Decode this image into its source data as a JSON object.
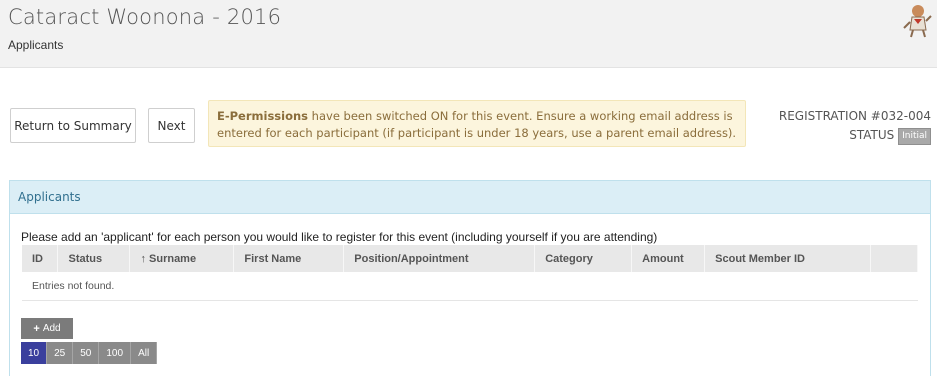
{
  "header": {
    "title": "Cataract Woonona - 2016",
    "subtitle": "Applicants"
  },
  "actions": {
    "return_label": "Return to Summary",
    "next_label": "Next"
  },
  "notice": {
    "bold": "E-Permissions",
    "text": " have been switched ON for this event. Ensure a working email address is entered for each participant (if participant is under 18 years, use a parent email address)."
  },
  "registration": {
    "number": "REGISTRATION #032-004",
    "status_label": "STATUS",
    "status_value": "Initial"
  },
  "panel": {
    "heading": "Applicants",
    "intro": "Please add an 'applicant' for each person you would like to register for this event (including yourself if you are attending)",
    "columns": [
      "ID",
      "Status",
      "↑ Surname",
      "First Name",
      "Position/Appointment",
      "Category",
      "Amount",
      "Scout Member ID",
      ""
    ],
    "empty_text": "Entries not found.",
    "add_label": "Add",
    "page_sizes": [
      "10",
      "25",
      "50",
      "100",
      "All"
    ],
    "page_size_selected": "10"
  },
  "colors": {
    "accent": "#3a3f9d",
    "panel_heading": "#dbeef6",
    "notice_bg": "#fcf5dd"
  }
}
